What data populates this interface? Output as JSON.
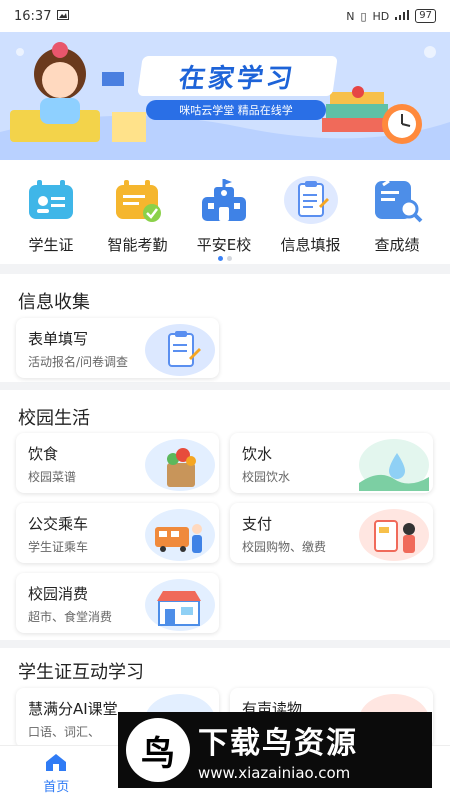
{
  "status": {
    "time": "16:37",
    "network": "HD",
    "battery": "97"
  },
  "banner": {
    "title": "在家学习",
    "subtitle": "咪咕云学堂 精品在线学"
  },
  "quick": {
    "items": [
      {
        "label": "学生证",
        "icon": "student-card-icon"
      },
      {
        "label": "智能考勤",
        "icon": "attendance-icon"
      },
      {
        "label": "平安E校",
        "icon": "school-icon"
      },
      {
        "label": "信息填报",
        "icon": "form-icon"
      },
      {
        "label": "查成绩",
        "icon": "grade-search-icon"
      }
    ]
  },
  "sections": {
    "info": {
      "title": "信息收集",
      "cards": [
        {
          "title": "表单填写",
          "subtitle": "活动报名/问卷调查"
        }
      ]
    },
    "campus": {
      "title": "校园生活",
      "cards": [
        {
          "title": "饮食",
          "subtitle": "校园菜谱"
        },
        {
          "title": "饮水",
          "subtitle": "校园饮水"
        },
        {
          "title": "公交乘车",
          "subtitle": "学生证乘车"
        },
        {
          "title": "支付",
          "subtitle": "校园购物、缴费"
        },
        {
          "title": "校园消费",
          "subtitle": "超市、食堂消费"
        }
      ]
    },
    "learning": {
      "title": "学生证互动学习",
      "cards": [
        {
          "title": "慧满分AI课堂",
          "subtitle": "口语、词汇、"
        },
        {
          "title": "有声读物",
          "subtitle": ""
        }
      ]
    }
  },
  "tabbar": {
    "home": "首页"
  },
  "watermark": {
    "brand": "下载鸟资源",
    "url": "www.xiazainiao.com"
  },
  "colors": {
    "accent": "#2f7bf5",
    "banner_bg": "#c9ddff"
  }
}
